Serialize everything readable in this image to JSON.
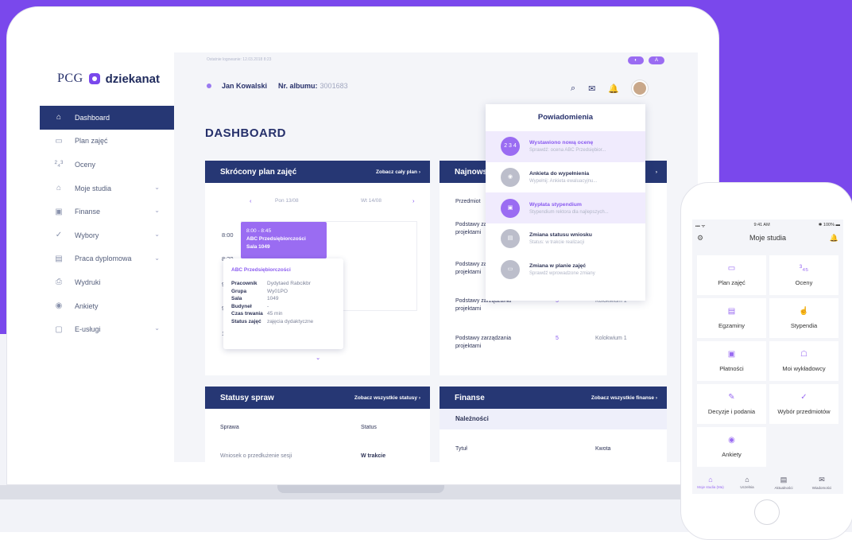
{
  "app": {
    "logo_left": "PCG",
    "logo_right": "dziekanat",
    "last_login": "Ostatnie logowanie: 12.03.2018 8:23",
    "btn1": "◐",
    "btn2": "A"
  },
  "sidebar": {
    "items": [
      {
        "label": "Dashboard",
        "icon": "⌂",
        "chev": ""
      },
      {
        "label": "Plan zajęć",
        "icon": "▭",
        "chev": ""
      },
      {
        "label": "Oceny",
        "icon": "²₄³",
        "chev": ""
      },
      {
        "label": "Moje studia",
        "icon": "⌂",
        "chev": "⌄"
      },
      {
        "label": "Finanse",
        "icon": "▣",
        "chev": "⌄"
      },
      {
        "label": "Wybory",
        "icon": "✓",
        "chev": "⌄"
      },
      {
        "label": "Praca dyplomowa",
        "icon": "▤",
        "chev": "⌄"
      },
      {
        "label": "Wydruki",
        "icon": "⎙",
        "chev": ""
      },
      {
        "label": "Ankiety",
        "icon": "◉",
        "chev": ""
      },
      {
        "label": "E-usługi",
        "icon": "▢",
        "chev": "⌄"
      }
    ]
  },
  "header": {
    "user": "Jan Kowalski",
    "album_label": "Nr. albumu:",
    "album_value": "3001683",
    "icons": [
      "⌕",
      "✉",
      "🔔"
    ]
  },
  "page_title": "DASHBOARD",
  "schedule": {
    "title": "Skrócony plan zajęć",
    "link": "Zobacz cały plan  ›",
    "prev": "‹",
    "day1": "Pon 13/08",
    "day2": "Wt 14/08",
    "next": "›",
    "times": [
      "8:00",
      "8:30",
      "9",
      "9",
      "1"
    ],
    "event": {
      "time": "8:00 - 8:45",
      "name": "ABC Przedsiębiorczości",
      "room": "Sala 1049"
    },
    "tooltip": {
      "title": "ABC Przedsiębiorczości",
      "rows": [
        {
          "k": "Pracownik",
          "v": "Dydytaed Rabcikbr"
        },
        {
          "k": "Grupa",
          "v": "Wy01PO"
        },
        {
          "k": "Sala",
          "v": "1049"
        },
        {
          "k": "Budyneł",
          "v": "-"
        },
        {
          "k": "Czas trwania",
          "v": "45 min"
        },
        {
          "k": "Status zajęć",
          "v": "zajęcia dydaktyczne"
        }
      ]
    },
    "more": "⌄"
  },
  "grades": {
    "title": "Najnows",
    "link": "›",
    "col1": "Przedmiot",
    "rows": [
      {
        "subj": "Podstawy za projektami",
        "grade": "",
        "type": ""
      },
      {
        "subj": "Podstawy za projektami",
        "grade": "",
        "type": ""
      },
      {
        "subj": "Podstawy zarządzania projektami",
        "grade": "5",
        "type": "Kolokwium 1"
      },
      {
        "subj": "Podstawy zarządzania projektami",
        "grade": "5",
        "type": "Kolokwium 1"
      }
    ]
  },
  "statuses": {
    "title": "Statusy spraw",
    "link": "Zobacz wszystkie statusy  ›",
    "col1": "Sprawa",
    "col2": "Status",
    "row": {
      "name": "Wniosek o przedłużenie sesji",
      "status": "W trakcie"
    }
  },
  "finance": {
    "title": "Finanse",
    "link": "Zobacz wszystkie finanse  ›",
    "sub": "Należności",
    "col1": "Tytuł",
    "col2": "Kwota"
  },
  "notifications": {
    "title": "Powiadomienia",
    "items": [
      {
        "icon": "2 3 4",
        "title": "Wystawiono nową ocenę",
        "sub": "Sprawdź: ocena ABC Przedsiębior...",
        "hl": true
      },
      {
        "icon": "◉",
        "title": "Ankieta do wypełnienia",
        "sub": "Wypełnij: Ankieta ewaluacyjnu...",
        "hl": false
      },
      {
        "icon": "▣",
        "title": "Wypłata stypendium",
        "sub": "Stypendium rektora dla najlepszych...",
        "hl": true
      },
      {
        "icon": "▤",
        "title": "Zmiana statusu wniosku",
        "sub": "Status: w trakcie realizacji",
        "hl": false
      },
      {
        "icon": "▭",
        "title": "Zmiana w planie zajęć",
        "sub": "Sprawdź wprowadzone zmiany",
        "hl": false
      }
    ]
  },
  "phone": {
    "time": "9:41 AM",
    "signal": "▪▪▪ ᯤ",
    "battery": "✱ 100% ▬",
    "title": "Moje studia",
    "gear": "⚙",
    "bell": "🔔",
    "tiles": [
      {
        "label": "Plan zajęć",
        "icon": "▭"
      },
      {
        "label": "Oceny",
        "icon": "³₄₅"
      },
      {
        "label": "Egzaminy",
        "icon": "▤"
      },
      {
        "label": "Stypendia",
        "icon": "☝"
      },
      {
        "label": "Płatności",
        "icon": "▣"
      },
      {
        "label": "Moi wykładowcy",
        "icon": "☖"
      },
      {
        "label": "Decyzje i podania",
        "icon": "✎"
      },
      {
        "label": "Wybór przedmiotów",
        "icon": "✓"
      },
      {
        "label": "Ankiety",
        "icon": "◉"
      }
    ],
    "tabs": [
      {
        "label": "Moje studia (Ma)",
        "icon": "⌂"
      },
      {
        "label": "Uczelnia",
        "icon": "⌂"
      },
      {
        "label": "Aktualności",
        "icon": "▤"
      },
      {
        "label": "Wiadomości",
        "icon": "✉"
      }
    ]
  }
}
